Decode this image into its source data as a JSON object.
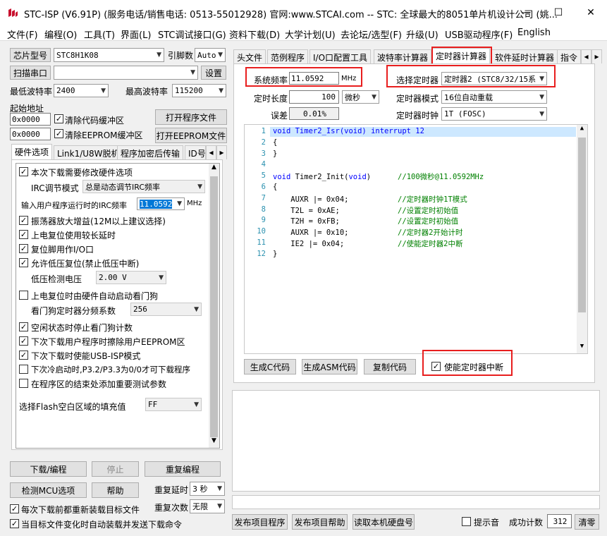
{
  "window": {
    "title": "STC-ISP (V6.91P) (服务电话/销售电话: 0513-55012928) 官网:www.STCAI.com  -- STC: 全球最大的8051单片机设计公司 (姚...",
    "minimize": "—",
    "maximize": "☐",
    "close": "✕"
  },
  "menu": [
    "文件(F)",
    "编程(O)",
    "工具(T)",
    "界面(L)",
    "STC调试接口(G)",
    "资料下载(D)",
    "大学计划(U)",
    "去论坛/选型(F)",
    "升级(U)",
    "USB驱动程序(F)",
    "English"
  ],
  "left": {
    "chip_label": "芯片型号",
    "chip_value": "STC8H1K08",
    "pin_label": "引脚数",
    "pin_value": "Auto",
    "scan_label": "扫描串口",
    "port_value": "",
    "settings_label": "设置",
    "min_baud_label": "最低波特率",
    "min_baud": "2400",
    "max_baud_label": "最高波特率",
    "max_baud": "115200",
    "start_addr_label": "起始地址",
    "addr1": "0x0000",
    "clear_code": "清除代码缓冲区",
    "open_program": "打开程序文件",
    "addr2": "0x0000",
    "clear_eeprom": "清除EEPROM缓冲区",
    "open_eeprom": "打开EEPROM文件",
    "tabs": [
      "硬件选项",
      "Link1/U8W脱机",
      "程序加密后传输",
      "ID号"
    ],
    "options": {
      "o1": "本次下载需要修改硬件选项",
      "irc_mode_label": "IRC调节模式",
      "irc_mode": "总是动态调节IRC频率",
      "irc_freq_label": "输入用户程序运行时的IRC频率",
      "irc_freq": "11.0592",
      "mhz": "MHz",
      "o2": "振荡器放大增益(12M以上建议选择)",
      "o3": "上电复位使用较长延时",
      "o4": "复位脚用作I/O口",
      "o5": "允许低压复位(禁止低压中断)",
      "lv_label": "低压检测电压",
      "lv_value": "2.00 V",
      "o6": "上电复位时由硬件自动启动看门狗",
      "wdt_label": "看门狗定时器分频系数",
      "wdt_value": "256",
      "o7": "空闲状态时停止看门狗计数",
      "o8": "下次下载用户程序时擦除用户EEPROM区",
      "o9": "下次下载时使能USB-ISP模式",
      "o10": "下次冷启动时,P3.2/P3.3为0/0才可下载程序",
      "o11": "在程序区的结束处添加重要测试参数",
      "fill_label": "选择Flash空白区域的填充值",
      "fill_value": "FF"
    },
    "download": "下载/编程",
    "stop": "停止",
    "reprogram": "重复编程",
    "check_mcu": "检测MCU选项",
    "help": "帮助",
    "repeat_delay_label": "重复延时",
    "repeat_delay": "3 秒",
    "repeat_count_label": "重复次数",
    "repeat_count": "无限",
    "reload_each": "每次下载前都重新装载目标文件",
    "auto_reload": "当目标文件变化时自动装载并发送下载命令"
  },
  "right": {
    "tabs": [
      "头文件",
      "范例程序",
      "I/O口配置工具",
      "波特率计算器",
      "定时器计算器",
      "软件延时计算器",
      "指令"
    ],
    "sysfreq_label": "系统频率",
    "sysfreq": "11.0592",
    "mhz": "MHz",
    "select_timer_label": "选择定时器",
    "timer": "定时器2 (STC8/32/15系",
    "length_label": "定时长度",
    "length": "100",
    "unit": "微秒",
    "mode_label": "定时器模式",
    "mode": "16位自动重载",
    "error_label": "误差",
    "error": "0.01%",
    "clock_label": "定时器时钟",
    "clock": "1T  (FOSC)",
    "code_lines": [
      {
        "n": "1",
        "t": "void Timer2_Isr(void) interrupt 12"
      },
      {
        "n": "2",
        "t": "{"
      },
      {
        "n": "3",
        "t": "}"
      },
      {
        "n": "4",
        "t": ""
      },
      {
        "n": "5",
        "t": "void Timer2_Init(void)      //100微秒@11.0592MHz"
      },
      {
        "n": "6",
        "t": "{"
      },
      {
        "n": "7",
        "t": "    AUXR |= 0x04;           //定时器时钟1T模式"
      },
      {
        "n": "8",
        "t": "    T2L = 0xAE;             //设置定时初始值"
      },
      {
        "n": "9",
        "t": "    T2H = 0xFB;             //设置定时初始值"
      },
      {
        "n": "10",
        "t": "    AUXR |= 0x10;           //定时器2开始计时"
      },
      {
        "n": "11",
        "t": "    IE2 |= 0x04;            //使能定时器2中断"
      },
      {
        "n": "12",
        "t": "}"
      }
    ],
    "gen_c": "生成C代码",
    "gen_asm": "生成ASM代码",
    "copy": "复制代码",
    "enable_int": "使能定时器中断",
    "publish": "发布项目程序",
    "publish_help": "发布项目帮助",
    "read_disk": "读取本机硬盘号",
    "beep": "提示音",
    "success_label": "成功计数",
    "success": "312",
    "clear": "清零"
  }
}
